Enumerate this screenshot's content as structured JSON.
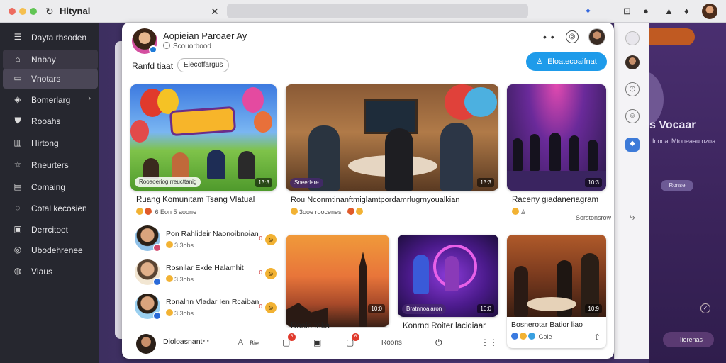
{
  "window": {
    "title": "Hitynal"
  },
  "sidebar": {
    "items": [
      {
        "label": "Dayta rhsoden",
        "icon": "menu-icon"
      },
      {
        "label": "Nnbay",
        "icon": "home-icon"
      },
      {
        "label": "Vnotars",
        "icon": "video-icon"
      },
      {
        "label": "Bomerlarg",
        "icon": "tag-icon"
      },
      {
        "label": "Rooahs",
        "icon": "shield-icon"
      },
      {
        "label": "Hirtong",
        "icon": "history-icon"
      },
      {
        "label": "Rneurters",
        "icon": "star-icon"
      },
      {
        "label": "Comaing",
        "icon": "document-icon"
      },
      {
        "label": "Cotal kecosien",
        "icon": "chat-icon"
      },
      {
        "label": "Derrcitoet",
        "icon": "bookmark-icon"
      },
      {
        "label": "Ubodehrenee",
        "icon": "globe-icon"
      },
      {
        "label": "Vlaus",
        "icon": "settings-icon"
      }
    ]
  },
  "header": {
    "title": "Aopieian Paroaer Ay",
    "subtitle": "Scouorbood",
    "dots": "• •",
    "filter_label": "Ranfd tiaat",
    "filter_chip": "Eiecoffargus",
    "cta_label": "Eloatecoaifnat"
  },
  "cards": [
    {
      "title": "Ruang Komunitam Tsang Vlatual",
      "meta": "6 Eon 5 aoone",
      "tag": "Rooaoeriog rreucttanig",
      "duration": "13:3",
      "scene": "balloons"
    },
    {
      "title": "Rou Nconmtinanftmiglamtpordamrlugrnyoualkian",
      "meta": "3ooe roocenes",
      "tag": "Sneerlare",
      "duration": "13:3",
      "scene": "restaurant"
    },
    {
      "title": "Raceny giadaneriagram",
      "meta": "Sorstonsrow",
      "tag": "",
      "duration": "10:3",
      "scene": "stage"
    },
    {
      "title": "Ronin toka",
      "meta": "",
      "tag": "",
      "duration": "10:0",
      "scene": "sunset"
    },
    {
      "title": "Konrng Roiter lacidiaar",
      "meta": "",
      "tag": "Bratnnoaiaron",
      "duration": "10:0",
      "scene": "neon"
    },
    {
      "title": "Bosnerotar Batior liao",
      "meta": "Goie",
      "tag": "",
      "duration": "10:9",
      "scene": "dinner"
    }
  ],
  "people": [
    {
      "name": "Pon Rahlideir Naonoibnoian",
      "meta": "3 3obs",
      "num": "0"
    },
    {
      "name": "Rosnilar Ekde Halamhit",
      "meta": "3 3obs",
      "num": "0"
    },
    {
      "name": "Ronalnn Vladar Ien Rcaiban",
      "meta": "3 3obs",
      "num": "0"
    }
  ],
  "bottom_bar": {
    "name": "Dioloasnant",
    "label": "Roons",
    "badges": [
      "6",
      "6"
    ],
    "mic_label": "Bie"
  },
  "right_panel": {
    "title": "s Vocaar",
    "subtitle": "Inooal Mtoneaau ozoa",
    "tag": "Ronse",
    "pill": "Iierenas"
  },
  "colors": {
    "accent": "#1e9bea",
    "sidebar_bg": "#26272f",
    "sidebar_active": "#4a4656"
  }
}
